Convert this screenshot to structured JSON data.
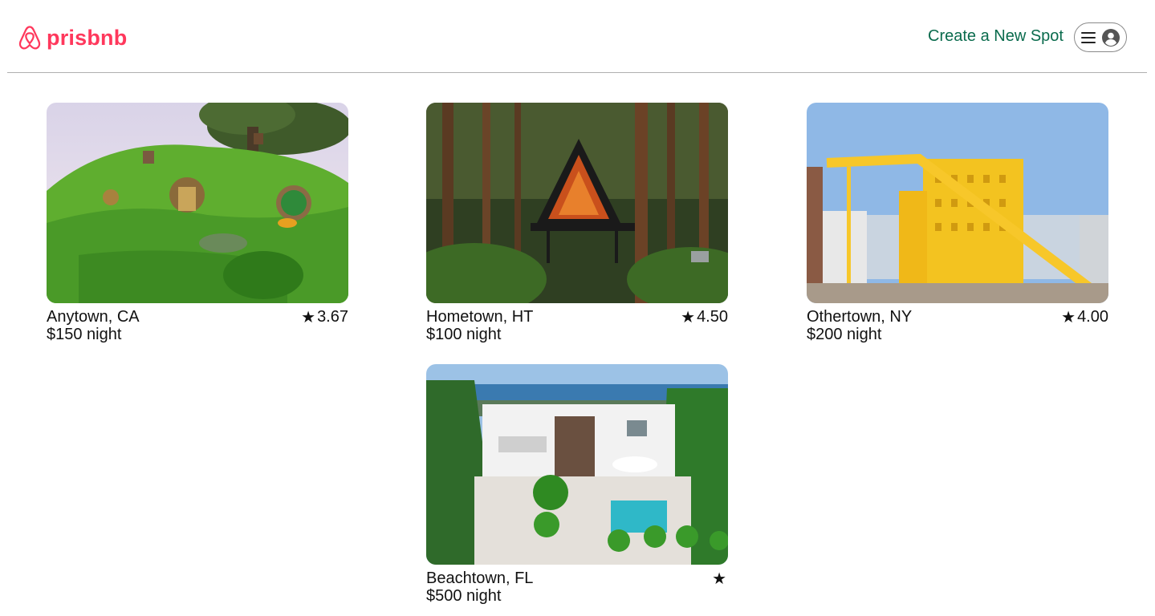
{
  "header": {
    "logo_text": "prisbnb",
    "create_link": "Create a New Spot"
  },
  "colors": {
    "brand": "#ff385c",
    "link": "#0a6b4d"
  },
  "spots": [
    {
      "location": "Anytown, CA",
      "rating": "3.67",
      "price": "$150 night",
      "image": "hobbit-hole-house"
    },
    {
      "location": "Hometown, HT",
      "rating": "4.50",
      "price": "$100 night",
      "image": "a-frame-forest-cabin"
    },
    {
      "location": "Othertown, NY",
      "rating": "4.00",
      "price": "$200 night",
      "image": "yellow-building-staircase"
    },
    {
      "location": "Beachtown, FL",
      "rating": "",
      "price": "$500 night",
      "image": "white-villa-pool"
    }
  ],
  "icons": {
    "logo": "airbnb-logo-icon",
    "menu": "hamburger-icon",
    "user": "user-circle-icon",
    "star": "star-icon"
  }
}
